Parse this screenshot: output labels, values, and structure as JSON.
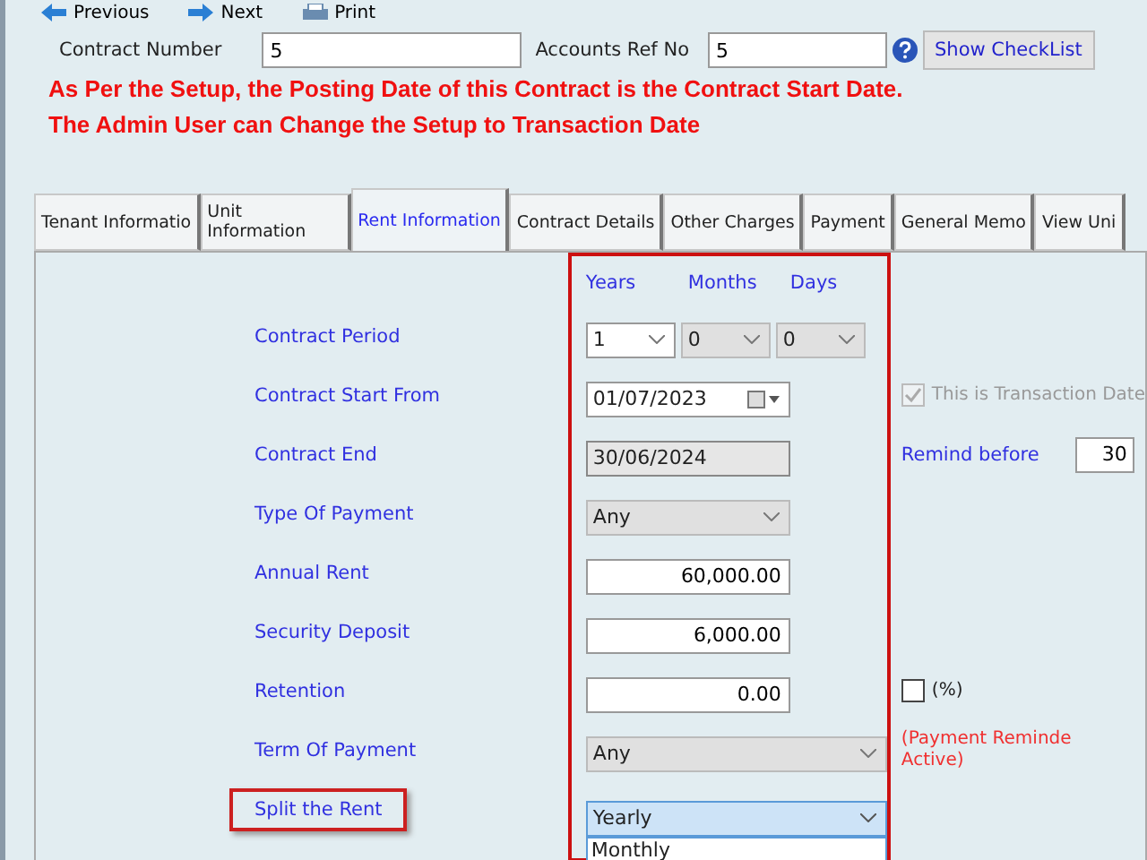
{
  "toolbar": [
    {
      "label": "Previous",
      "kind": "prev"
    },
    {
      "label": "Next",
      "kind": "next"
    },
    {
      "label": "Print",
      "kind": "print"
    }
  ],
  "header": {
    "contract_number": {
      "label": "Contract Number",
      "value": "5"
    },
    "accounts_ref": {
      "label": "Accounts Ref No",
      "value": "5"
    },
    "checklist_button": "Show CheckList"
  },
  "notices": [
    "As Per the Setup, the Posting Date of this Contract is the Contract Start Date.",
    "The Admin User can Change the Setup to Transaction Date"
  ],
  "tabs": [
    {
      "label": "Tenant Informatio",
      "selected": false
    },
    {
      "label": "Unit Information",
      "selected": false
    },
    {
      "label": "Rent Information",
      "selected": true
    },
    {
      "label": "Contract Details",
      "selected": false
    },
    {
      "label": "Other Charges",
      "selected": false
    },
    {
      "label": "Payment",
      "selected": false
    },
    {
      "label": "General Memo",
      "selected": false
    },
    {
      "label": "View Uni",
      "selected": false
    }
  ],
  "period_headers": [
    "Years",
    "Months",
    "Days"
  ],
  "rows": [
    {
      "kind": "period",
      "label": "Contract Period",
      "values": [
        {
          "value": "1",
          "disabled": false
        },
        {
          "value": "0",
          "disabled": true
        },
        {
          "value": "0",
          "disabled": true
        }
      ]
    },
    {
      "kind": "date",
      "label": "Contract Start From",
      "value": "01/07/2023",
      "checkbox": {
        "label": "This is Transaction Date",
        "checked": true,
        "disabled": true
      }
    },
    {
      "kind": "readonly",
      "label": "Contract End",
      "value": "30/06/2024",
      "remind": {
        "label": "Remind before",
        "value": "30"
      }
    },
    {
      "kind": "select",
      "label": "Type Of Payment",
      "value": "Any",
      "disabled": true,
      "wide": false
    },
    {
      "kind": "number",
      "label": "Annual Rent",
      "value": "60,000.00"
    },
    {
      "kind": "number",
      "label": "Security Deposit",
      "value": "6,000.00"
    },
    {
      "kind": "number",
      "label": "Retention",
      "value": "0.00",
      "checkbox": {
        "label": "(%)",
        "checked": false,
        "disabled": false
      }
    },
    {
      "kind": "select",
      "label": "Term Of Payment",
      "value": "Any",
      "disabled": true,
      "wide": true,
      "note": [
        "(Payment Reminde",
        "Active)"
      ]
    },
    {
      "kind": "dropdown",
      "label": "Split the Rent",
      "value": "Yearly",
      "highlighted": true,
      "options": [
        "Monthly"
      ]
    }
  ]
}
